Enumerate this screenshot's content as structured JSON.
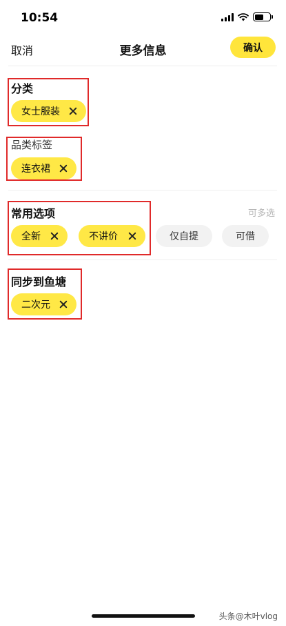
{
  "status_bar": {
    "time": "10:54"
  },
  "nav": {
    "cancel": "取消",
    "title": "更多信息",
    "confirm": "确认"
  },
  "sections": {
    "category": {
      "title": "分类",
      "chip": "女士服装"
    },
    "category_tag": {
      "title": "品类标签",
      "chip": "连衣裙"
    },
    "common_options": {
      "title": "常用选项",
      "hint": "可多选",
      "selected": [
        "全新",
        "不讲价"
      ],
      "unselected": [
        "仅自提",
        "可借"
      ]
    },
    "sync": {
      "title": "同步到鱼塘",
      "chip": "二次元"
    }
  },
  "watermark": "头条@木叶vlog",
  "colors": {
    "accent": "#ffe53b",
    "highlight": "#e02a2a"
  }
}
